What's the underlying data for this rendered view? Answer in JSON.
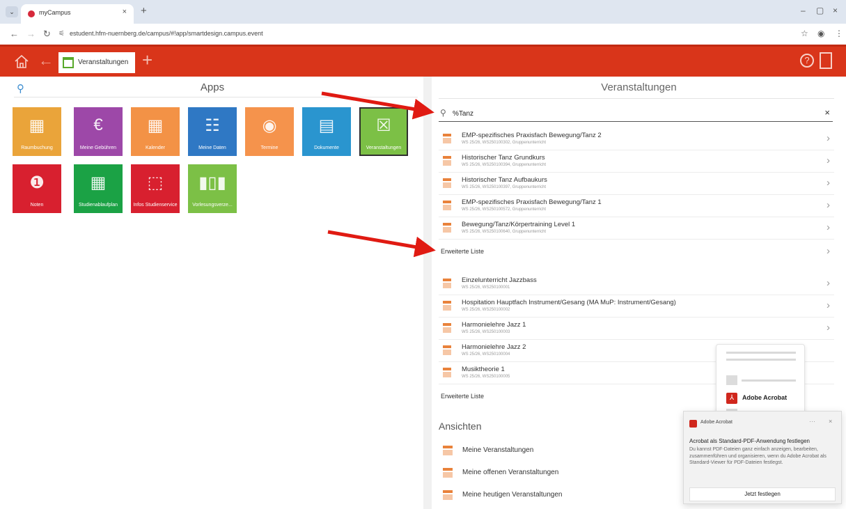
{
  "browser": {
    "tab_title": "myCampus",
    "tab_close": "×",
    "new_tab": "+",
    "url": "estudent.hfm-nuernberg.de/campus/#!app/smartdesign.campus.event",
    "win_min": "–",
    "win_restore": "▢",
    "win_close": "×"
  },
  "colors": {
    "brand_red": "#d9351a",
    "accent_blue": "#3e8ed0",
    "selection_green": "#58a92b"
  },
  "header": {
    "active_tab": "Veranstaltungen",
    "help_glyph": "?"
  },
  "apps": {
    "title": "Apps",
    "tiles": [
      {
        "label": "Raumbuchung",
        "color": "#eaa43a",
        "glyph": "▦",
        "icon": "room-booking-icon"
      },
      {
        "label": "Meine Gebühren",
        "color": "#9d48a8",
        "glyph": "€",
        "icon": "fees-icon"
      },
      {
        "label": "Kalender",
        "color": "#f39246",
        "glyph": "▦",
        "icon": "calendar-icon"
      },
      {
        "label": "Meine Daten",
        "color": "#2f78c4",
        "glyph": "☷",
        "icon": "id-card-icon"
      },
      {
        "label": "Termine",
        "color": "#f5934c",
        "glyph": "◉",
        "icon": "appointment-icon"
      },
      {
        "label": "Dokumente",
        "color": "#2a95cf",
        "glyph": "▤",
        "icon": "document-icon"
      },
      {
        "label": "Veranstaltungen",
        "color": "#7cc046",
        "glyph": "☒",
        "icon": "event-icon"
      },
      {
        "label": "Noten",
        "color": "#d8202f",
        "glyph": "❶",
        "icon": "grades-icon"
      },
      {
        "label": "Studienablaufplan",
        "color": "#1ba245",
        "glyph": "▦",
        "icon": "study-plan-icon"
      },
      {
        "label": "Infos Studienservice",
        "color": "#d8202f",
        "glyph": "⬚",
        "icon": "info-frame-icon"
      },
      {
        "label": "Vorlesungsverze...",
        "color": "#7cc046",
        "glyph": "▮▯▮",
        "icon": "course-catalog-icon"
      }
    ]
  },
  "events": {
    "title": "Veranstaltungen",
    "search_value": "%Tanz",
    "clear": "×",
    "search_results": [
      {
        "title": "EMP-spezifisches Praxisfach Bewegung/Tanz 2",
        "subtitle": "WS 25/26, WS250100302, Gruppenunterricht"
      },
      {
        "title": "Historischer Tanz Grundkurs",
        "subtitle": "WS 25/26, WS250100394, Gruppenunterricht"
      },
      {
        "title": "Historischer Tanz Aufbaukurs",
        "subtitle": "WS 25/26, WS250100397, Gruppenunterricht"
      },
      {
        "title": "EMP-spezifisches Praxisfach Bewegung/Tanz 1",
        "subtitle": "WS 25/26, WS250100572, Gruppenunterricht"
      },
      {
        "title": "Bewegung/Tanz/Körpertraining Level 1",
        "subtitle": "WS 25/26, WS250100640, Gruppenunterricht"
      }
    ],
    "extended_list_label": "Erweiterte Liste",
    "all_events": [
      {
        "title": "Einzelunterricht Jazzbass",
        "subtitle": "WS 25/26, WS250100001"
      },
      {
        "title": "Hospitation Hauptfach Instrument/Gesang (MA MuP: Instrument/Gesang)",
        "subtitle": "WS 25/26, WS250100002"
      },
      {
        "title": "Harmonielehre Jazz 1",
        "subtitle": "WS 25/26, WS250100003"
      },
      {
        "title": "Harmonielehre Jazz 2",
        "subtitle": "WS 25/26, WS250100004"
      },
      {
        "title": "Musiktheorie 1",
        "subtitle": "WS 25/26, WS250100005"
      }
    ],
    "extended_list_label_2": "Erweiterte Liste"
  },
  "views": {
    "title": "Ansichten",
    "items": [
      "Meine Veranstaltungen",
      "Meine offenen Veranstaltungen",
      "Meine heutigen Veranstaltungen"
    ]
  },
  "acrobat": {
    "card_name": "Adobe Acrobat",
    "toast_app": "Adobe Acrobat",
    "toast_more": "···",
    "toast_close": "×",
    "toast_title": "Acrobat als Standard-PDF-Anwendung festlegen",
    "toast_body": "Du kannst PDF-Dateien ganz einfach anzeigen, bearbeiten, zusammenführen und organisieren, wenn du Adobe Acrobat als Standard-Viewer für PDF-Dateien festlegst.",
    "toast_button": "Jetzt festlegen"
  }
}
